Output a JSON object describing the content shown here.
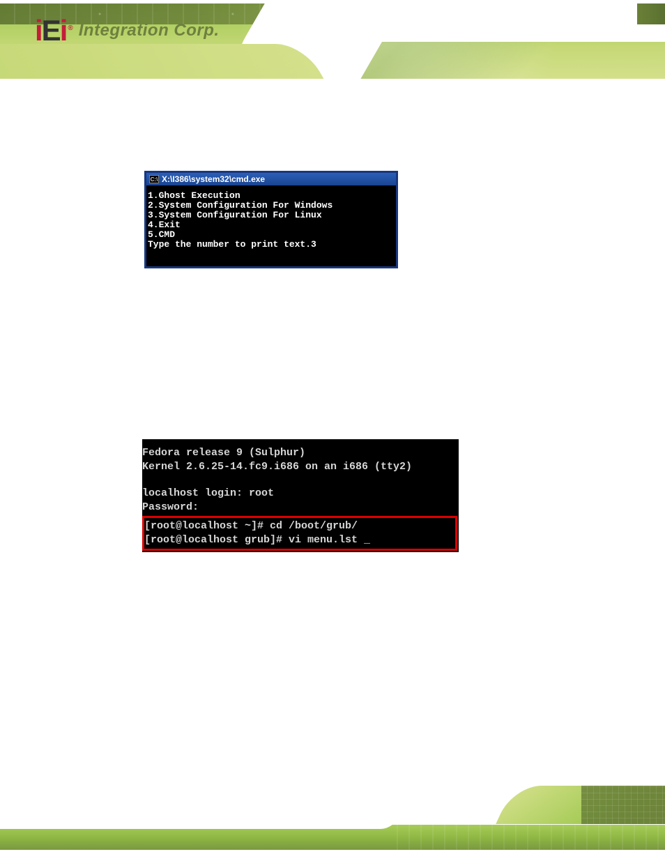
{
  "header": {
    "logo_brand": "iEi",
    "logo_registered": "®",
    "logo_text": "Integration Corp."
  },
  "cmd_window": {
    "icon_text": "C:\\",
    "title": "X:\\I386\\system32\\cmd.exe",
    "lines": [
      "1.Ghost Execution",
      "2.System Configuration For Windows",
      "3.System Configuration For Linux",
      "4.Exit",
      "5.CMD",
      "Type the number to print text.3"
    ]
  },
  "linux_terminal": {
    "line1": "Fedora release 9 (Sulphur)",
    "line2": "Kernel 2.6.25-14.fc9.i686 on an i686 (tty2)",
    "line3": "localhost login: root",
    "line4": "Password:",
    "box_line1": "[root@localhost ~]# cd /boot/grub/",
    "box_line2": "[root@localhost grub]# vi menu.lst _"
  }
}
